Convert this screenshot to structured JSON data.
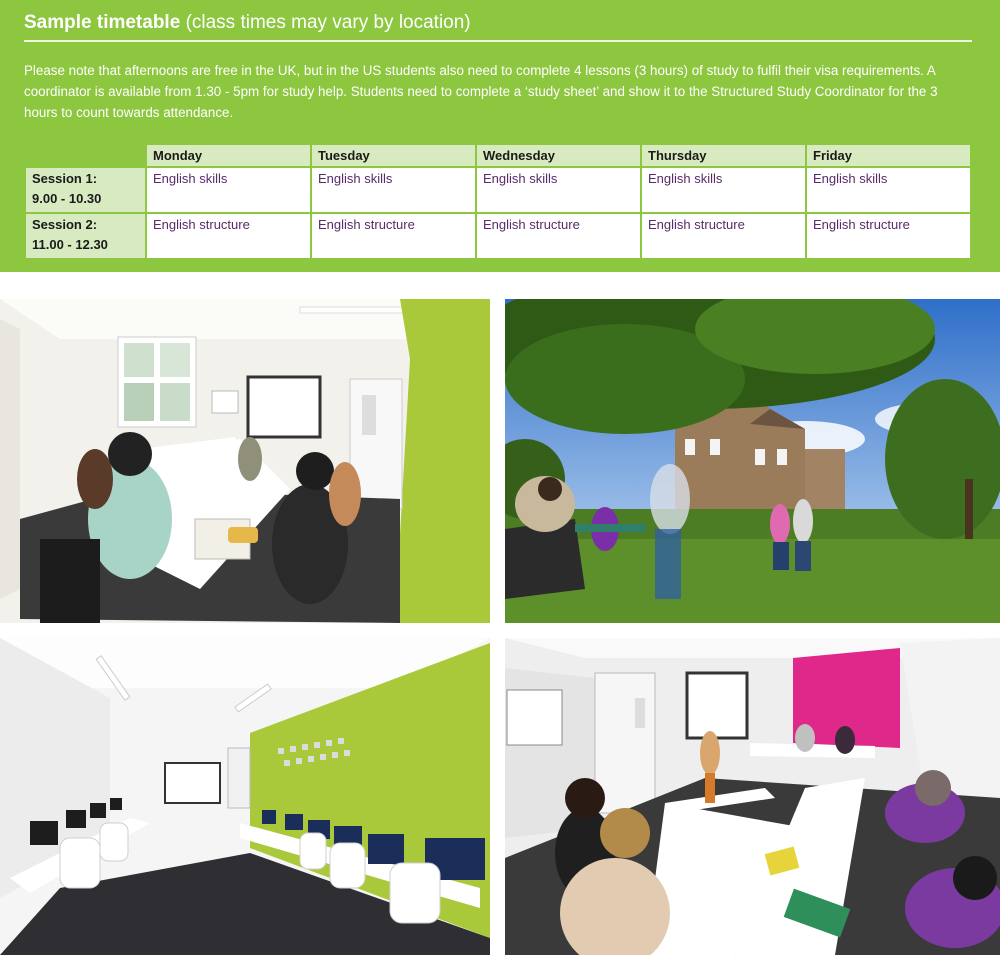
{
  "panel": {
    "title": "Sample timetable",
    "subtitle": "(class times may vary by location)",
    "note": "Please note that afternoons are free in the UK, but in the US students also need to complete 4 lessons (3 hours) of study to fulfil their visa requirements. A coordinator is available from 1.30 - 5pm for study help. Students need to complete a ‘study sheet’ and show it to the Structured Study Coordinator for the 3 hours to count towards attendance."
  },
  "timetable": {
    "days": [
      "Monday",
      "Tuesday",
      "Wednesday",
      "Thursday",
      "Friday"
    ],
    "sessions": [
      {
        "name": "Session 1:",
        "time": "9.00 - 10.30",
        "cells": [
          "English skills",
          "English skills",
          "English skills",
          "English skills",
          "English skills"
        ]
      },
      {
        "name": "Session 2:",
        "time": "11.00 - 12.30",
        "cells": [
          "English structure",
          "English structure",
          "English structure",
          "English structure",
          "English structure"
        ]
      }
    ]
  },
  "photos": {
    "classroom_green_wall": "photo",
    "garden_students": "photo",
    "computer_lab": "photo",
    "classroom_pink_wall": "photo"
  },
  "colors": {
    "panel_green": "#8dc63f",
    "header_cell": "#d8ebc0",
    "cell_text": "#5a2a6a",
    "wall_lime": "#a9c93a",
    "wall_pink": "#e0278a"
  }
}
